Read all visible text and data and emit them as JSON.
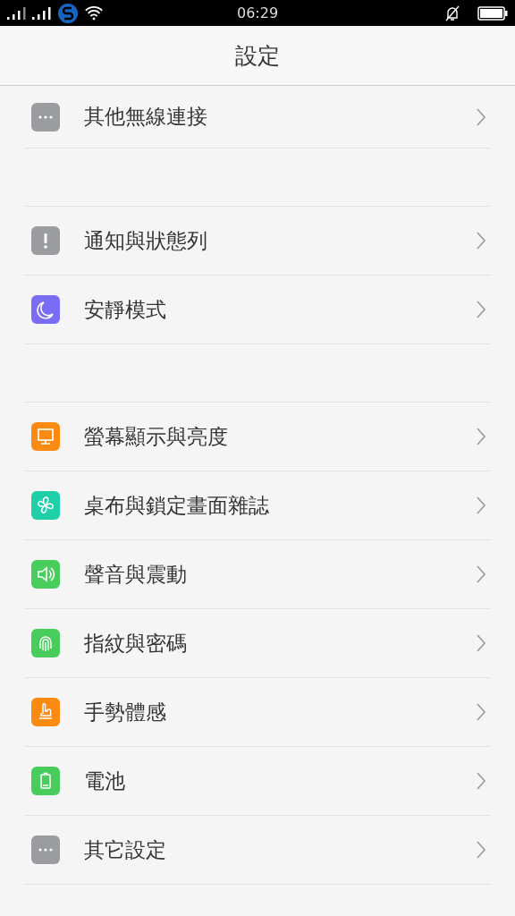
{
  "status_bar": {
    "time": "06:29"
  },
  "header": {
    "title": "設定"
  },
  "groups": [
    {
      "items": [
        {
          "label": "其他無線連接",
          "kind": "dots",
          "color": "#9a9ca0"
        }
      ]
    },
    {
      "items": [
        {
          "label": "通知與狀態列",
          "kind": "exclamation",
          "color": "#9a9ca0"
        },
        {
          "label": "安靜模式",
          "kind": "moon",
          "color": "#7b6cf6"
        }
      ]
    },
    {
      "items": [
        {
          "label": "螢幕顯示與亮度",
          "kind": "monitor",
          "color": "#fb8a12"
        },
        {
          "label": "桌布與鎖定畫面雜誌",
          "kind": "pinwheel",
          "color": "#1fcfa8"
        },
        {
          "label": "聲音與震動",
          "kind": "speaker",
          "color": "#48cd5c"
        },
        {
          "label": "指紋與密碼",
          "kind": "fingerprint",
          "color": "#48cd5c"
        },
        {
          "label": "手勢體感",
          "kind": "hand",
          "color": "#fb8a12"
        },
        {
          "label": "電池",
          "kind": "battery",
          "color": "#48cd5c"
        },
        {
          "label": "其它設定",
          "kind": "dots",
          "color": "#9a9ca0"
        }
      ]
    }
  ]
}
